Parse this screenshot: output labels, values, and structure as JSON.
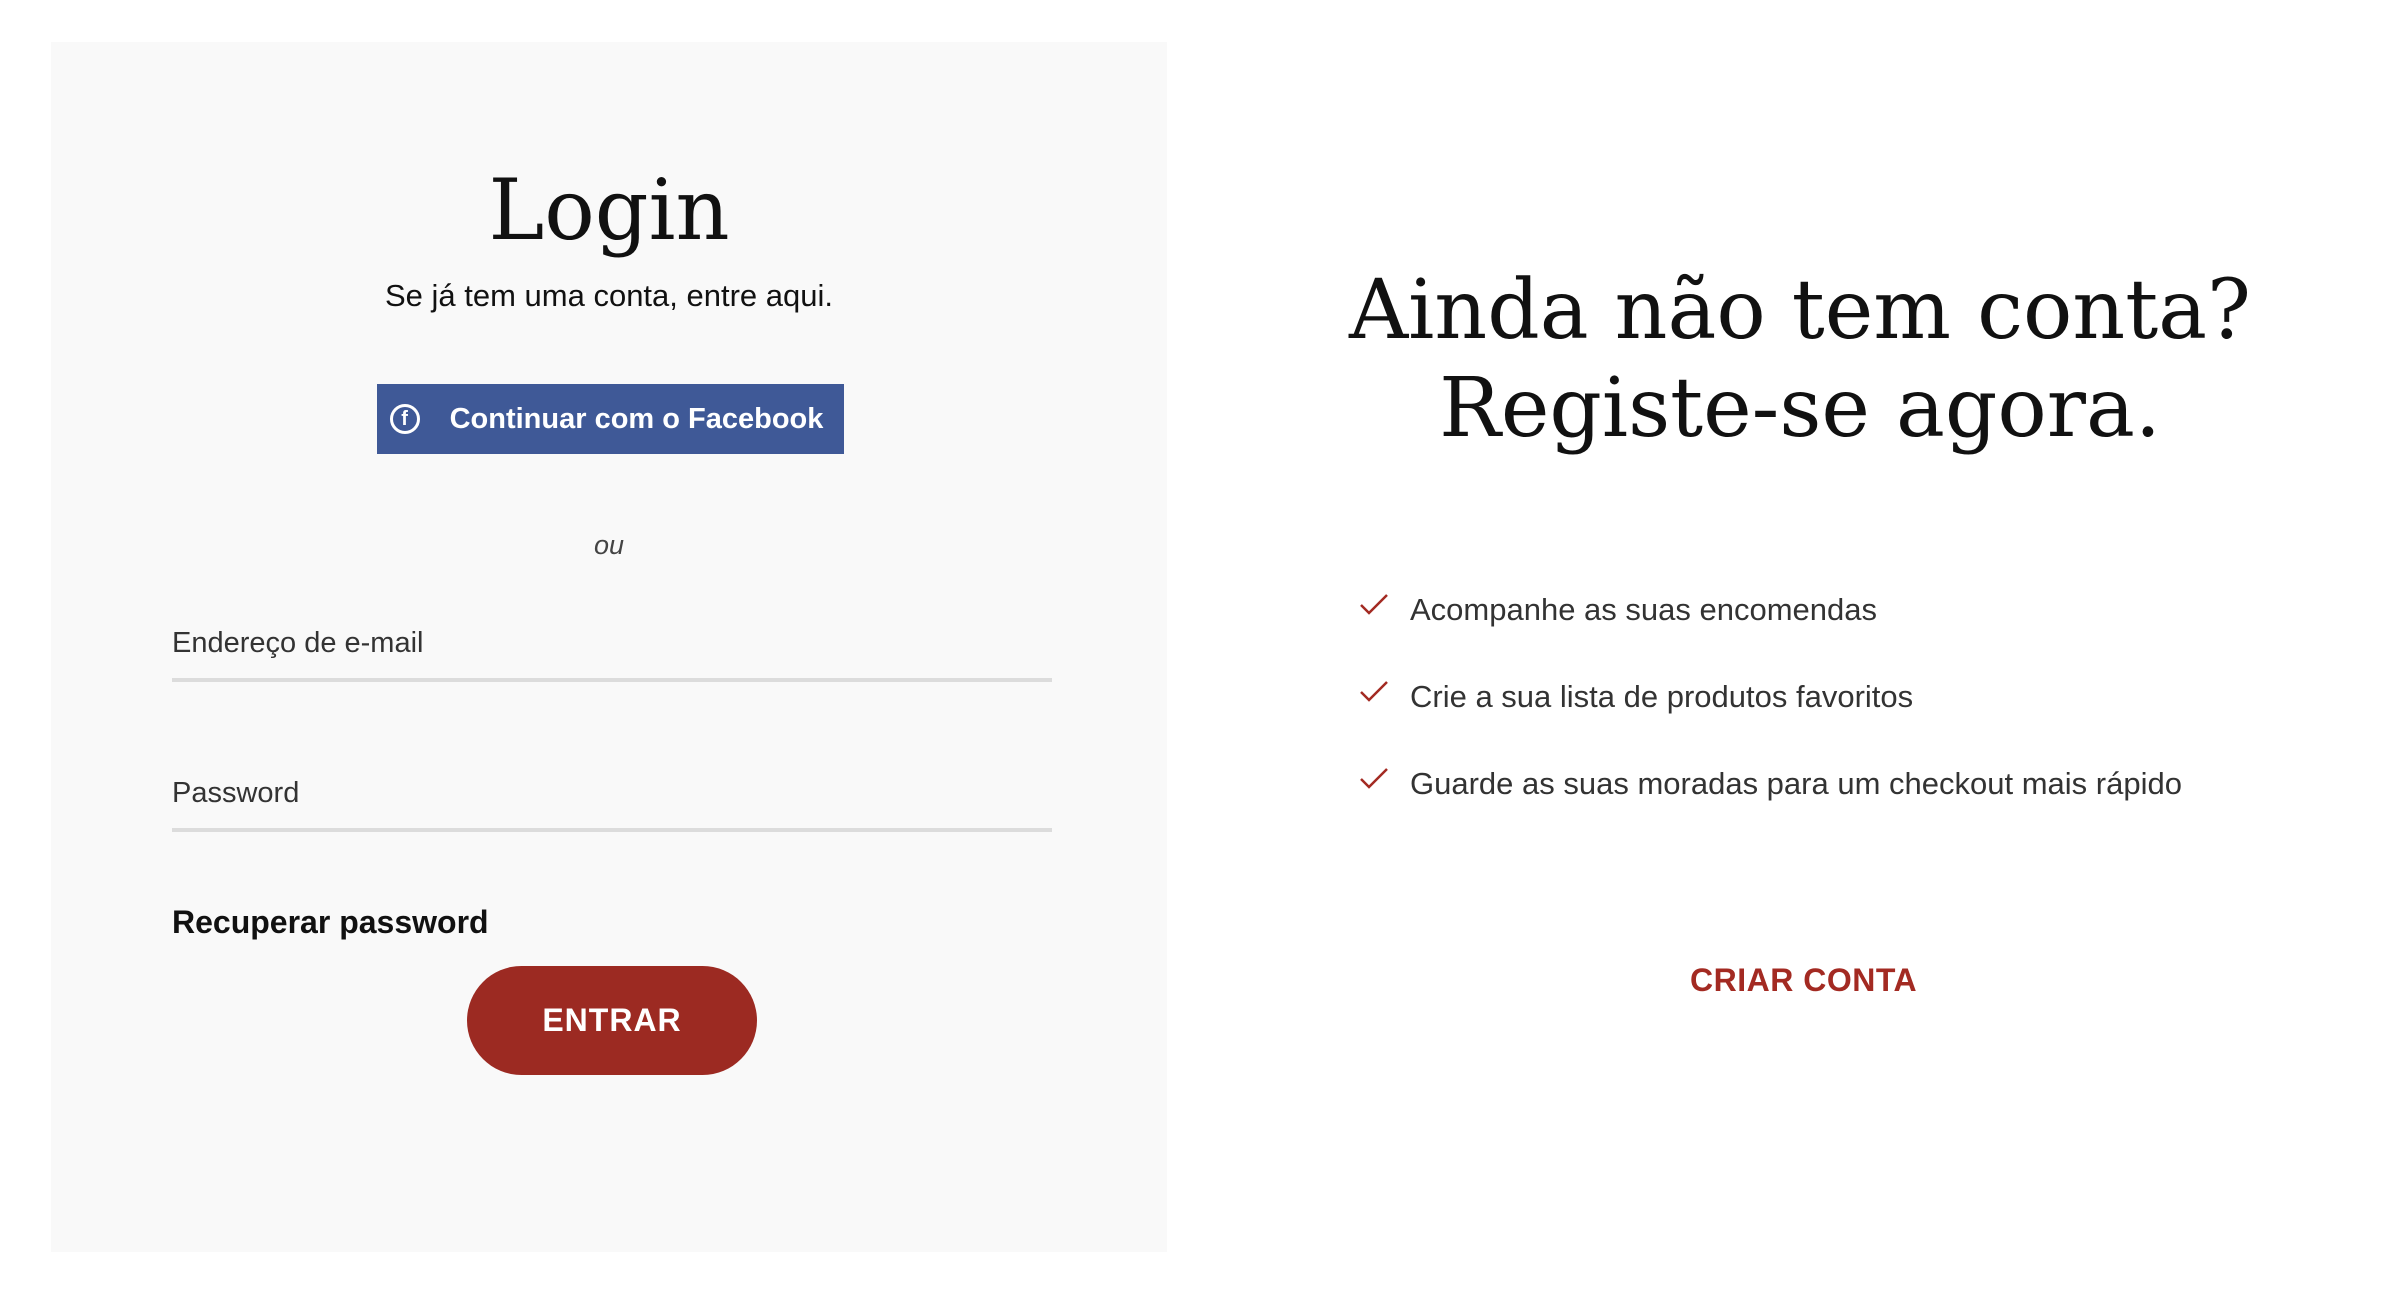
{
  "login": {
    "title": "Login",
    "subtitle": "Se já tem uma conta, entre aqui.",
    "facebook_label": "Continuar com o Facebook",
    "facebook_icon": "facebook-icon",
    "or_text": "ou",
    "email_placeholder": "Endereço de e-mail",
    "password_placeholder": "Password",
    "recover_label": "Recuperar password",
    "submit_label": "ENTRAR"
  },
  "register": {
    "title_line1": "Ainda não tem conta?",
    "title_line2": "Registe-se agora.",
    "benefits": [
      "Acompanhe as suas encomendas",
      "Crie a sua lista de produtos favoritos",
      "Guarde as suas moradas para um checkout mais rápido"
    ],
    "benefit_icon": "check-icon",
    "create_label": "CRIAR CONTA"
  },
  "colors": {
    "facebook_blue": "#3f5997",
    "accent_red": "#9c2a22",
    "panel_bg": "#f9f9f9"
  }
}
